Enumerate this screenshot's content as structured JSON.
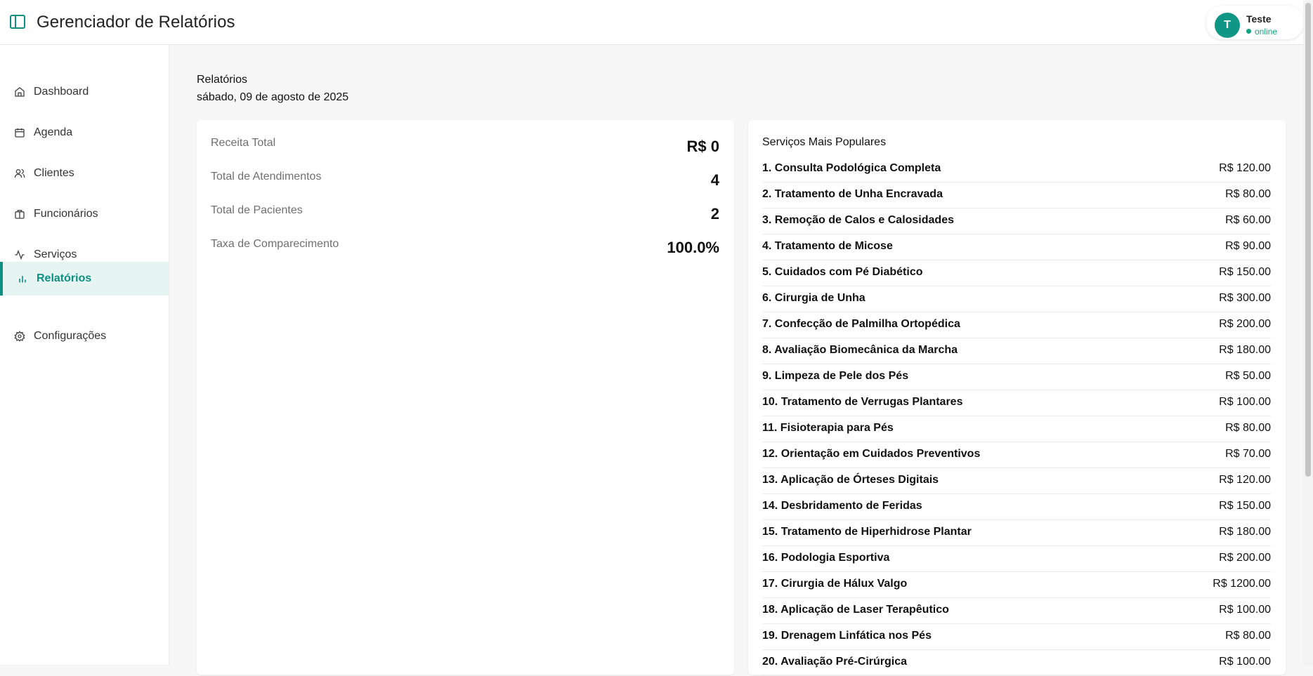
{
  "header": {
    "title": "Gerenciador de Relatórios",
    "user": {
      "initial": "T",
      "name": "Teste",
      "status": "online"
    }
  },
  "sidebar": {
    "items": [
      {
        "label": "Dashboard",
        "icon": "home-icon"
      },
      {
        "label": "Agenda",
        "icon": "calendar-icon"
      },
      {
        "label": "Clientes",
        "icon": "users-icon"
      },
      {
        "label": "Funcionários",
        "icon": "briefcase-icon"
      },
      {
        "label": "Serviços",
        "icon": "activity-icon"
      },
      {
        "label": "Relatórios",
        "icon": "bar-chart-icon",
        "active": true
      },
      {
        "label": "Configurações",
        "icon": "gear-icon"
      }
    ]
  },
  "page": {
    "title": "Relatórios",
    "date": "sábado, 09 de agosto de 2025"
  },
  "stats": [
    {
      "label": "Receita Total",
      "value": "R$ 0"
    },
    {
      "label": "Total de Atendimentos",
      "value": "4"
    },
    {
      "label": "Total de Pacientes",
      "value": "2"
    },
    {
      "label": "Taxa de Comparecimento",
      "value": "100.0%"
    }
  ],
  "popular": {
    "title": "Serviços Mais Populares",
    "items": [
      {
        "name": "1. Consulta Podológica Completa",
        "price": "R$ 120.00"
      },
      {
        "name": "2. Tratamento de Unha Encravada",
        "price": "R$ 80.00"
      },
      {
        "name": "3. Remoção de Calos e Calosidades",
        "price": "R$ 60.00"
      },
      {
        "name": "4. Tratamento de Micose",
        "price": "R$ 90.00"
      },
      {
        "name": "5. Cuidados com Pé Diabético",
        "price": "R$ 150.00"
      },
      {
        "name": "6. Cirurgia de Unha",
        "price": "R$ 300.00"
      },
      {
        "name": "7. Confecção de Palmilha Ortopédica",
        "price": "R$ 200.00"
      },
      {
        "name": "8. Avaliação Biomecânica da Marcha",
        "price": "R$ 180.00"
      },
      {
        "name": "9. Limpeza de Pele dos Pés",
        "price": "R$ 50.00"
      },
      {
        "name": "10. Tratamento de Verrugas Plantares",
        "price": "R$ 100.00"
      },
      {
        "name": "11. Fisioterapia para Pés",
        "price": "R$ 80.00"
      },
      {
        "name": "12. Orientação em Cuidados Preventivos",
        "price": "R$ 70.00"
      },
      {
        "name": "13. Aplicação de Órteses Digitais",
        "price": "R$ 120.00"
      },
      {
        "name": "14. Desbridamento de Feridas",
        "price": "R$ 150.00"
      },
      {
        "name": "15. Tratamento de Hiperhidrose Plantar",
        "price": "R$ 180.00"
      },
      {
        "name": "16. Podologia Esportiva",
        "price": "R$ 200.00"
      },
      {
        "name": "17. Cirurgia de Hálux Valgo",
        "price": "R$ 1200.00"
      },
      {
        "name": "18. Aplicação de Laser Terapêutico",
        "price": "R$ 100.00"
      },
      {
        "name": "19. Drenagem Linfática nos Pés",
        "price": "R$ 80.00"
      },
      {
        "name": "20. Avaliação Pré-Cirúrgica",
        "price": "R$ 100.00"
      }
    ]
  }
}
